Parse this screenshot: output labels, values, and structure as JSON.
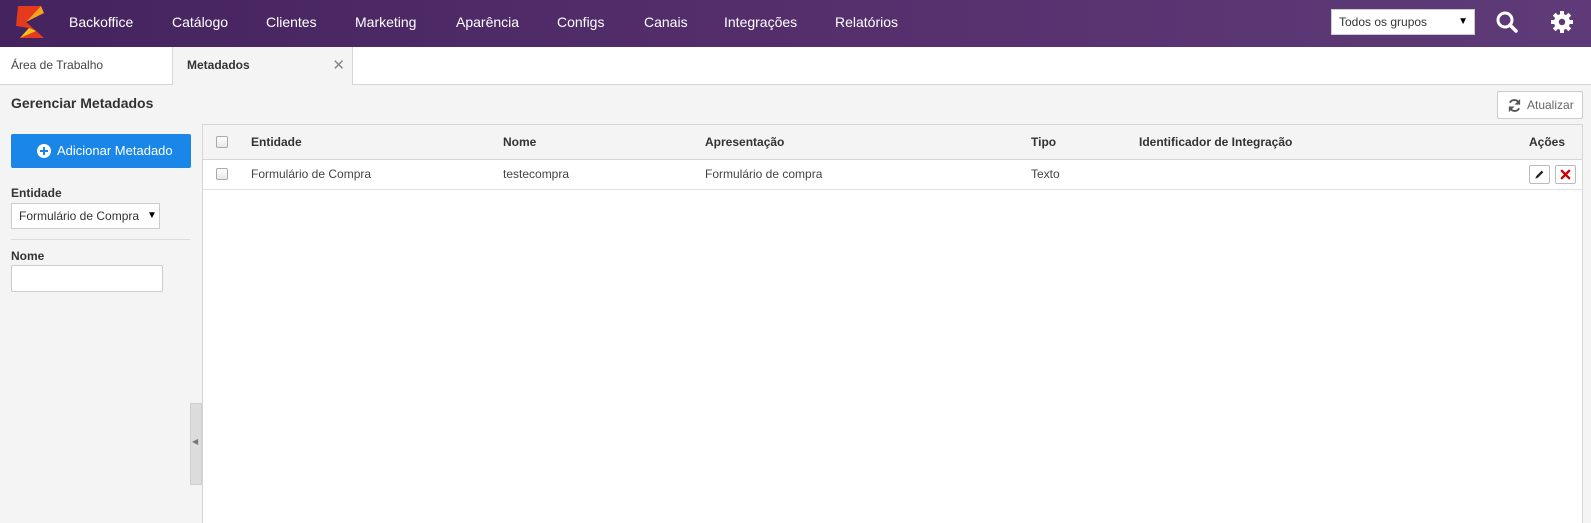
{
  "topnav": {
    "items": [
      "Backoffice",
      "Catálogo",
      "Clientes",
      "Marketing",
      "Aparência",
      "Configs",
      "Canais",
      "Integrações",
      "Relatórios"
    ],
    "group_select": "Todos os grupos",
    "icons": [
      "logo",
      "search-icon",
      "gear-icon"
    ]
  },
  "tabs": {
    "workspace": "Área de Trabalho",
    "active": "Metadados",
    "close": "✕"
  },
  "page": {
    "title": "Gerenciar Metadados",
    "refresh_label": "Atualizar"
  },
  "sidebar": {
    "add_button": "Adicionar Metadado",
    "entity_label": "Entidade",
    "entity_value": "Formulário de Compra",
    "name_label": "Nome",
    "name_value": ""
  },
  "table": {
    "columns": [
      "Entidade",
      "Nome",
      "Apresentação",
      "Tipo",
      "Identificador de Integração",
      "Ações"
    ],
    "rows": [
      {
        "entidade": "Formulário de Compra",
        "nome": "testecompra",
        "apresentacao": "Formulário de compra",
        "tipo": "Texto",
        "identificador": ""
      }
    ]
  },
  "colors": {
    "nav_start": "#44235e",
    "nav_end": "#5e3b78",
    "primary_button": "#1a86e8",
    "delete_icon": "#cc0000"
  }
}
